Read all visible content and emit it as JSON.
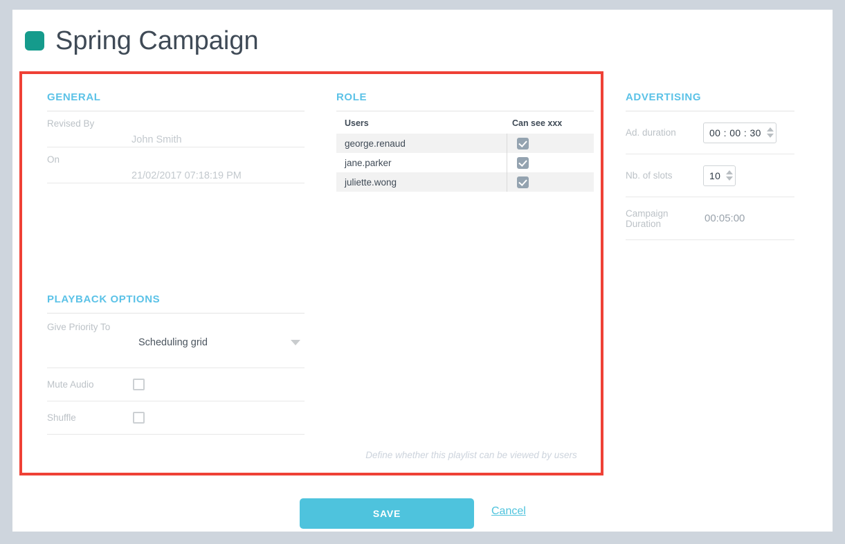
{
  "page": {
    "title": "Spring Campaign",
    "title_swatch_color": "#159b8c",
    "accent_color": "#5bc2e7",
    "annotation_color": "#ef4136"
  },
  "general": {
    "heading": "GENERAL",
    "rows": [
      {
        "label": "Revised By",
        "value": "John Smith"
      },
      {
        "label": "On",
        "value": "21/02/2017 07:18:19 PM"
      }
    ]
  },
  "playback": {
    "heading": "PLAYBACK OPTIONS",
    "priority": {
      "label": "Give Priority To",
      "value": "Scheduling grid",
      "caret": "chevron-down-icon"
    },
    "mute_audio": {
      "label": "Mute Audio",
      "checked": false
    },
    "shuffle": {
      "label": "Shuffle",
      "checked": false
    }
  },
  "role": {
    "heading": "ROLE",
    "columns": [
      "Users",
      "Can see xxx"
    ],
    "rows": [
      {
        "user": "george.renaud",
        "can_see": true
      },
      {
        "user": "jane.parker",
        "can_see": true
      },
      {
        "user": "juliette.wong",
        "can_see": true
      }
    ],
    "hint": "Define whether this playlist can be viewed by users"
  },
  "advertising": {
    "heading": "ADVERTISING",
    "ad_duration": {
      "label": "Ad. duration",
      "value": "00 : 00 : 30"
    },
    "nb_of_slots": {
      "label": "Nb. of slots",
      "value": "10"
    },
    "campaign_duration": {
      "label": "Campaign Duration",
      "value": "00:05:00"
    }
  },
  "footer": {
    "save_label": "SAVE",
    "cancel_label": "Cancel"
  }
}
